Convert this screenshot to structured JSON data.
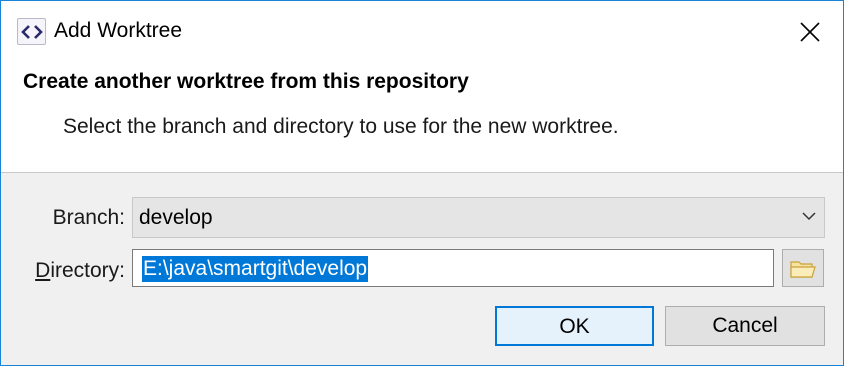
{
  "window": {
    "title": "Add Worktree",
    "app_icon": "code-brackets-icon"
  },
  "header": {
    "title": "Create another worktree from this repository",
    "description": "Select the branch and directory to use for the new worktree."
  },
  "form": {
    "branch_label_prefix": "Branch:",
    "branch_value": "develop",
    "directory_label_underlined": "D",
    "directory_label_rest": "irectory:",
    "directory_value": "E:\\java\\smartgit\\develop",
    "browse_icon": "folder-icon"
  },
  "buttons": {
    "ok_label": "OK",
    "cancel_label": "Cancel"
  },
  "colors": {
    "accent": "#0078d7",
    "window_border": "#1883d7",
    "body_bg": "#f0f0f0"
  }
}
